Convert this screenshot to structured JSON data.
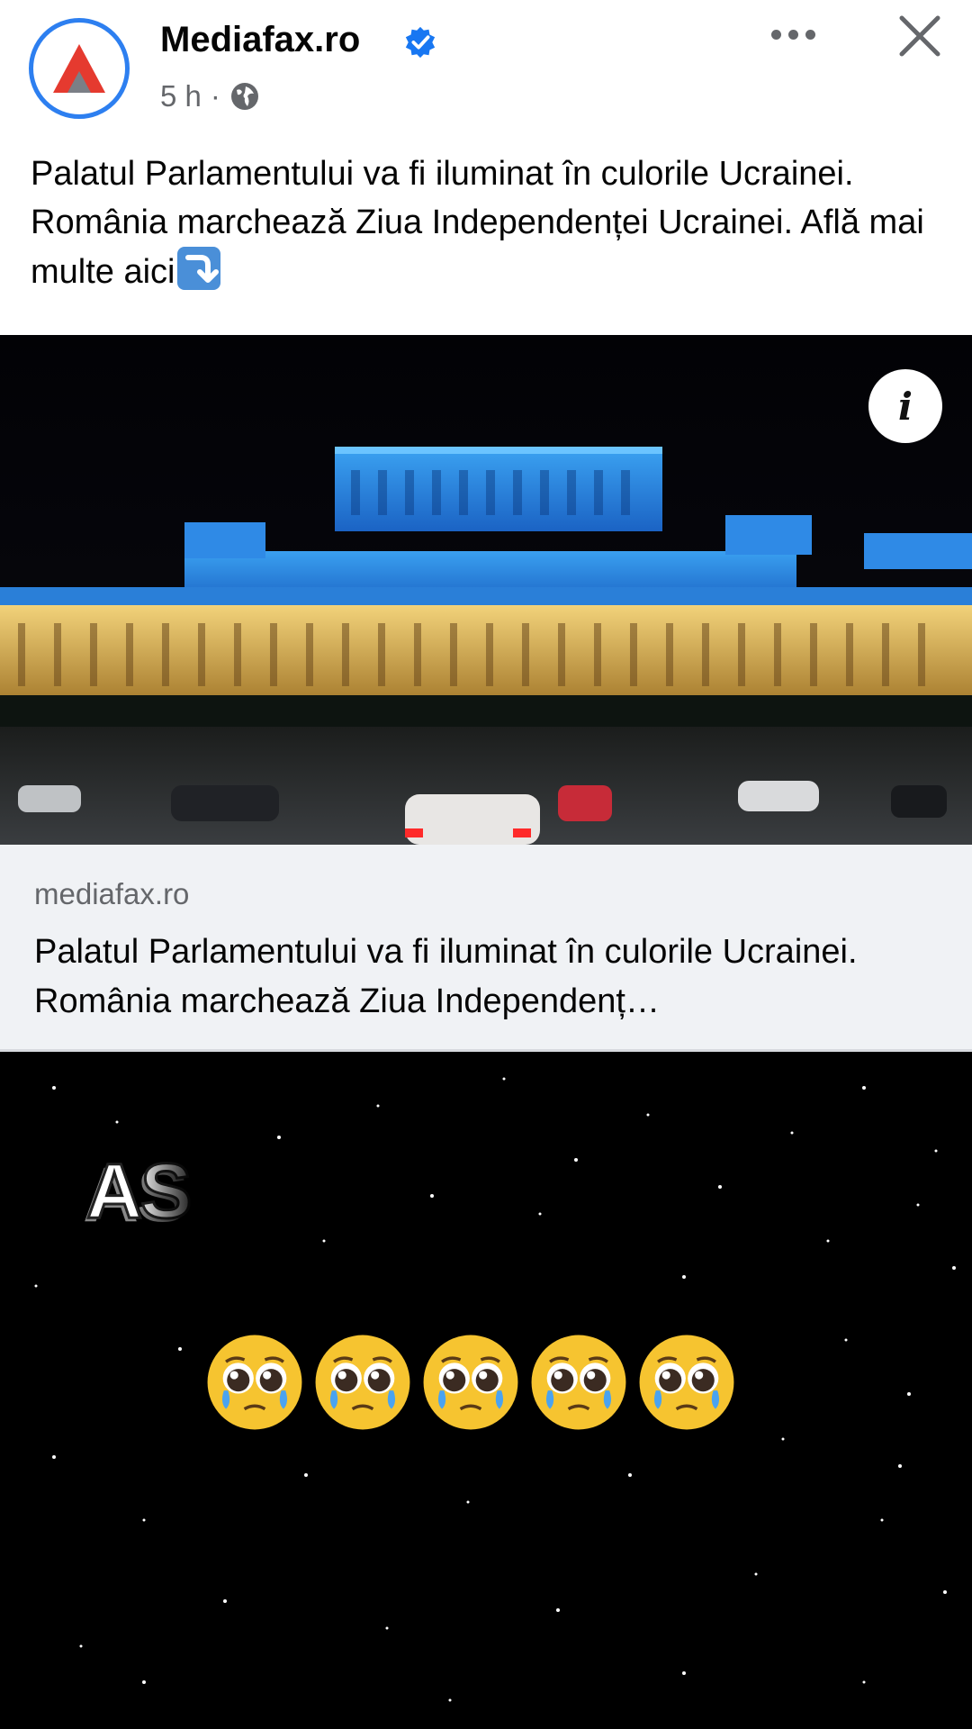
{
  "post": {
    "page_name": "Mediafax.ro",
    "time": "5 h",
    "separator": "·",
    "caption": "Palatul Parlamentului va fi iluminat în culorile Ucrainei. România marchează Ziua Independenței Ucrainei. Află mai multe aici"
  },
  "link_card": {
    "domain": "mediafax.ro",
    "title": "Palatul Parlamentului va fi iluminat în culorile Ucrainei. România marchează Ziua Independenț…"
  },
  "video": {
    "overlay_text": "AS",
    "emoji_count": 5
  },
  "colors": {
    "accent_blue": "#2d7ff0",
    "text_primary": "#050505",
    "text_secondary": "#65676b",
    "card_bg": "#f0f2f5"
  }
}
